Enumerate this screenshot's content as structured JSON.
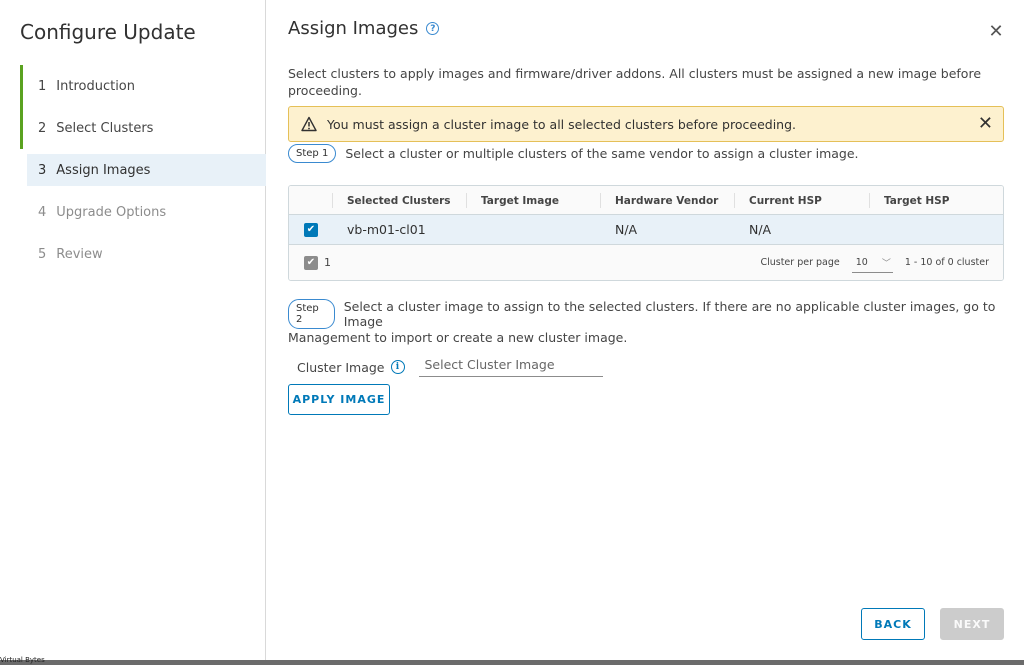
{
  "sidebar": {
    "title": "Configure Update",
    "steps": [
      {
        "num": "1",
        "label": "Introduction"
      },
      {
        "num": "2",
        "label": "Select Clusters"
      },
      {
        "num": "3",
        "label": "Assign Images"
      },
      {
        "num": "4",
        "label": "Upgrade Options"
      },
      {
        "num": "5",
        "label": "Review"
      }
    ]
  },
  "main": {
    "title": "Assign Images",
    "description": "Select clusters to apply images and firmware/driver addons. All clusters must be assigned a new image before proceeding.",
    "alert": "You must assign a cluster image to all selected clusters before proceeding.",
    "step1": {
      "pill": "Step 1",
      "text": "Select a cluster or multiple clusters of the same vendor to assign a cluster image."
    },
    "grid": {
      "headers": [
        "Selected Clusters",
        "Target Image",
        "Hardware Vendor",
        "Current HSP",
        "Target HSP"
      ],
      "rows": [
        {
          "cluster": "vb-m01-cl01",
          "target_image": "",
          "vendor": "N/A",
          "current_hsp": "N/A",
          "target_hsp": ""
        }
      ],
      "selected_count": "1",
      "per_page_label": "Cluster per page",
      "per_page": "10",
      "range": "1 - 10 of 0 cluster"
    },
    "step2": {
      "pill": "Step 2",
      "text_line1": "Select a cluster image to assign to the selected clusters. If there are no applicable cluster images, go to Image",
      "text_line2": "Management to import or create a new cluster image."
    },
    "cluster_image": {
      "label": "Cluster Image",
      "placeholder": "Select Cluster Image"
    },
    "apply_label": "APPLY IMAGE",
    "back_label": "BACK",
    "next_label": "NEXT"
  },
  "footer_text": "Virtual Bytes",
  "colors": {
    "accent": "#0079b8",
    "done": "#5aa220",
    "warning_bg": "#fdf1cf",
    "selected_bg": "#e8f1f8"
  }
}
